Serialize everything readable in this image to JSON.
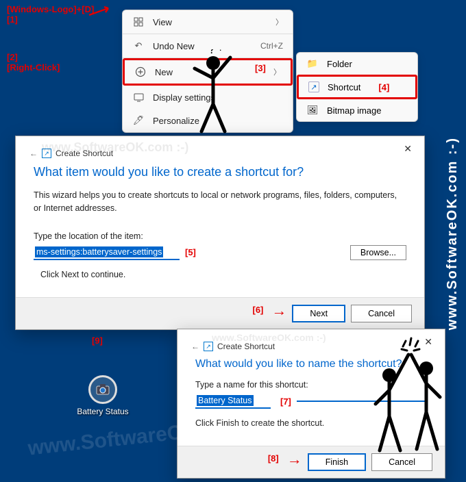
{
  "annotations": {
    "a1": "[Windows-Logo]+[D]",
    "a1n": "[1]",
    "a2": "[2]",
    "a2b": "[Right-Click]",
    "a3": "[3]",
    "a4": "[4]",
    "a5": "[5]",
    "a6": "[6]",
    "a7": "[7]",
    "a8": "[8]",
    "a9": "[9]"
  },
  "menu": {
    "view": "View",
    "undo": "Undo New",
    "undo_sc": "Ctrl+Z",
    "new": "New",
    "display": "Display settings",
    "personalize": "Personalize"
  },
  "submenu": {
    "folder": "Folder",
    "shortcut": "Shortcut",
    "bitmap": "Bitmap image"
  },
  "dialog1": {
    "breadcrumb": "Create Shortcut",
    "title": "What item would you like to create a shortcut for?",
    "desc": "This wizard helps you to create shortcuts to local or network programs, files, folders, computers, or Internet addresses.",
    "loc_label": "Type the location of the item:",
    "loc_value": "ms-settings:batterysaver-settings",
    "browse": "Browse...",
    "hint": "Click Next to continue.",
    "next": "Next",
    "cancel": "Cancel"
  },
  "dialog2": {
    "breadcrumb": "Create Shortcut",
    "title": "What would you like to name the shortcut?",
    "name_label": "Type a name for this shortcut:",
    "name_value": "Battery Status",
    "hint": "Click Finish to create the shortcut.",
    "finish": "Finish",
    "cancel": "Cancel"
  },
  "desktop_icon": {
    "label": "Battery Status"
  },
  "watermark": "www.SoftwareOK.com :-)"
}
